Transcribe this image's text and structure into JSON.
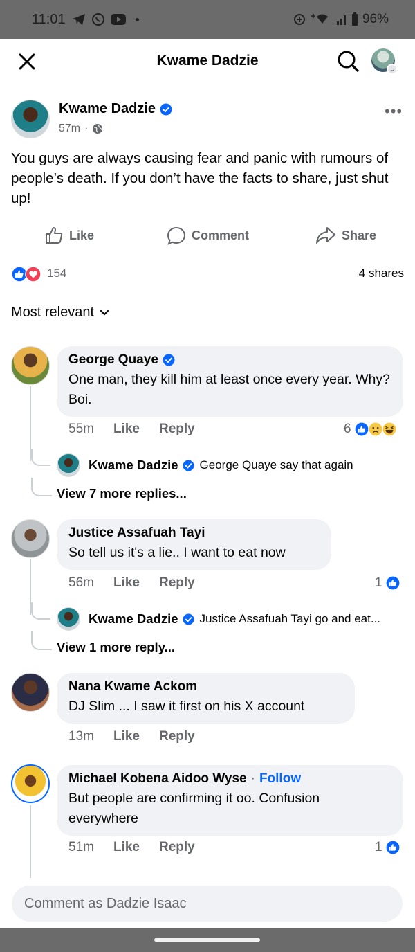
{
  "status": {
    "time": "11:01",
    "battery": "96%"
  },
  "header": {
    "title": "Kwame Dadzie"
  },
  "post": {
    "author": "Kwame Dadzie",
    "time": "57m",
    "separator": "·",
    "text": "You guys are always causing fear and panic with rumours of people’s death. If you don’t have the facts to share, just shut up!",
    "actions": {
      "like": "Like",
      "comment": "Comment",
      "share": "Share"
    },
    "reaction_count": "154",
    "shares": "4 shares"
  },
  "sort": {
    "label": "Most relevant"
  },
  "comments": [
    {
      "name": "George Quaye",
      "text": "One man, they kill him at least once every year. Why? Boi.",
      "time": "55m",
      "like": "Like",
      "reply": "Reply",
      "reactions": "6",
      "reply_preview": {
        "name": "Kwame Dadzie",
        "text": "George Quaye say that again"
      },
      "more_replies": "View 7 more replies..."
    },
    {
      "name": "Justice Assafuah Tayi",
      "text": "So tell us it's a lie.. I want to eat now",
      "time": "56m",
      "like": "Like",
      "reply": "Reply",
      "reactions": "1",
      "reply_preview": {
        "name": "Kwame Dadzie",
        "text": "Justice Assafuah Tayi go and eat..."
      },
      "more_replies": "View 1 more reply..."
    },
    {
      "name": "Nana Kwame Ackom",
      "text": "DJ Slim ... I saw it first on his X account",
      "time": "13m",
      "like": "Like",
      "reply": "Reply"
    },
    {
      "name": "Michael Kobena Aidoo Wyse",
      "follow": "Follow",
      "dot": "·",
      "text": "But people are confirming it oo. Confusion everywhere",
      "time": "51m",
      "like": "Like",
      "reply": "Reply",
      "reactions": "1"
    }
  ],
  "composer": {
    "placeholder": "Comment as Dadzie Isaac"
  },
  "colors": {
    "accent": "#0866ff",
    "bubble": "#f0f2f5",
    "muted": "#65676b",
    "love": "#f33e58"
  }
}
